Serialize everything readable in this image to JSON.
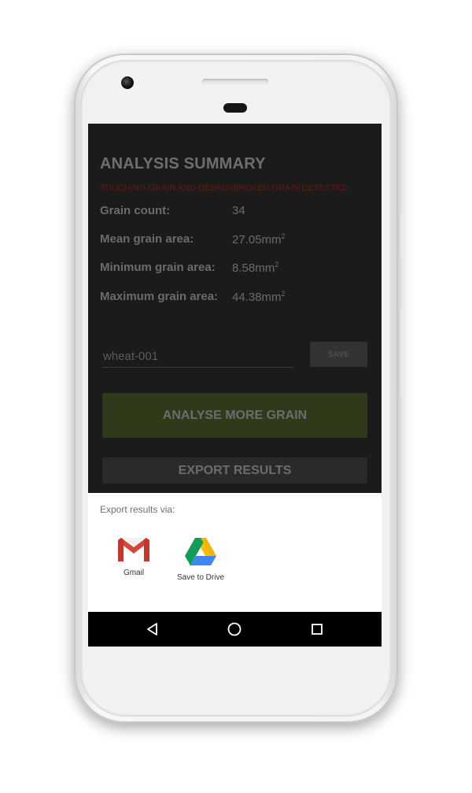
{
  "analysis": {
    "title": "ANALYSIS SUMMARY",
    "warning": "TOUCHING GRAIN AND DEBRIS/BROKEN GRAIN DETECTED",
    "stats": [
      {
        "label": "Grain count:",
        "value": "34",
        "unit": ""
      },
      {
        "label": "Mean grain area:",
        "value": "27.05mm",
        "unit": "2"
      },
      {
        "label": "Minimum grain area:",
        "value": "8.58mm",
        "unit": "2"
      },
      {
        "label": "Maximum grain area:",
        "value": "44.38mm",
        "unit": "2"
      }
    ]
  },
  "form": {
    "name_value": "wheat-001",
    "save_label": "SAVE"
  },
  "buttons": {
    "analyse_more": "ANALYSE MORE GRAIN",
    "export_results": "EXPORT RESULTS"
  },
  "share_sheet": {
    "title": "Export results via:",
    "items": [
      {
        "label": "Gmail",
        "icon": "gmail-icon"
      },
      {
        "label": "Save to Drive",
        "icon": "google-drive-icon"
      }
    ]
  },
  "navigation": {
    "back_icon": "back-triangle-icon",
    "home_icon": "home-circle-icon",
    "recents_icon": "recents-square-icon"
  },
  "colors": {
    "warning": "#6a1515",
    "analyse_button": "#2e3a1a",
    "navbar": "#000000"
  }
}
